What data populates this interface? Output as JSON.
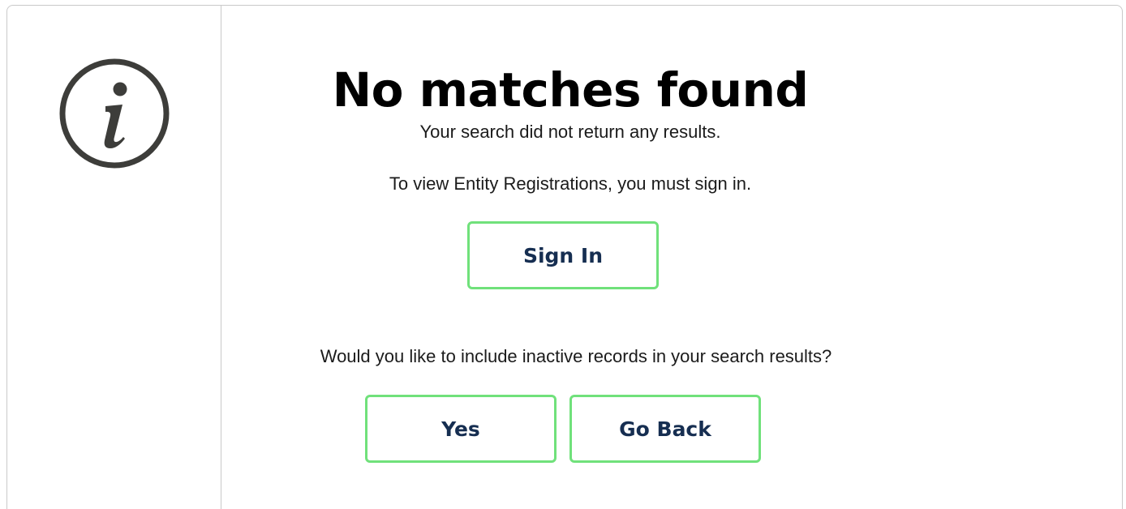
{
  "notice": {
    "icon": "info-icon",
    "title": "No matches found",
    "subtitle": "Your search did not return any results.",
    "signin_message": "To view Entity Registrations, you must sign in.",
    "signin_button": "Sign In",
    "inactive_question": "Would you like to include inactive records in your search results?",
    "yes_button": "Yes",
    "go_back_button": "Go Back"
  },
  "colors": {
    "button_border": "#70e17b",
    "button_text": "#162e51",
    "icon": "#3d3d3a",
    "divider": "#c9c9c9"
  }
}
